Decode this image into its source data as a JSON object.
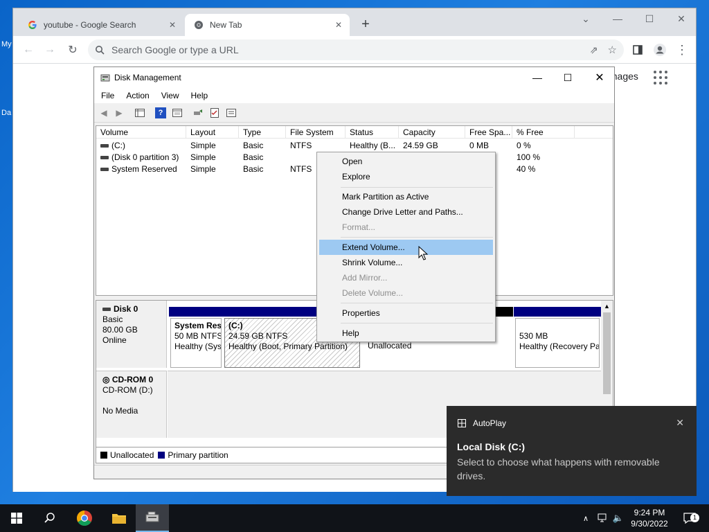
{
  "desktop": {
    "icon_labels": [
      "My",
      "Da"
    ]
  },
  "browser": {
    "tabs": [
      {
        "title": "youtube - Google Search",
        "icon": "google-g-icon",
        "active": false
      },
      {
        "title": "New Tab",
        "icon": "chrome-icon",
        "active": true
      }
    ],
    "omnibox_placeholder": "Search Google or type a URL",
    "images_link": "Images"
  },
  "disk_management": {
    "title": "Disk Management",
    "menu": [
      "File",
      "Action",
      "View",
      "Help"
    ],
    "columns": [
      "Volume",
      "Layout",
      "Type",
      "File System",
      "Status",
      "Capacity",
      "Free Spa...",
      "% Free"
    ],
    "rows": [
      {
        "volume": "(C:)",
        "layout": "Simple",
        "type": "Basic",
        "fs": "NTFS",
        "status": "Healthy (B...",
        "capacity": "24.59 GB",
        "free": "0 MB",
        "pct": "0 %"
      },
      {
        "volume": "(Disk 0 partition 3)",
        "layout": "Simple",
        "type": "Basic",
        "fs": "",
        "status": "",
        "capacity": "",
        "free": "",
        "pct": "100 %"
      },
      {
        "volume": "System Reserved",
        "layout": "Simple",
        "type": "Basic",
        "fs": "NTFS",
        "status": "",
        "capacity": "",
        "free": "",
        "pct": "40 %"
      }
    ],
    "disk0": {
      "name": "Disk 0",
      "type": "Basic",
      "size": "80.00 GB",
      "state": "Online",
      "partitions": [
        {
          "name": "System Res",
          "size": "50 MB NTFS",
          "status": "Healthy (Sys"
        },
        {
          "name": "(C:)",
          "size": "24.59 GB NTFS",
          "status": "Healthy (Boot, Primary Partition)"
        },
        {
          "name": "",
          "size": "",
          "status": "Unallocated"
        },
        {
          "name": "",
          "size": "530 MB",
          "status": "Healthy (Recovery Pa"
        }
      ]
    },
    "cdrom": {
      "name": "CD-ROM 0",
      "type": "CD-ROM (D:)",
      "media": "No Media"
    },
    "legend": [
      {
        "label": "Unallocated",
        "color": "#000000"
      },
      {
        "label": "Primary partition",
        "color": "#000080"
      }
    ]
  },
  "context_menu": {
    "items": [
      {
        "label": "Open",
        "enabled": true
      },
      {
        "label": "Explore",
        "enabled": true
      },
      {
        "label": "Mark Partition as Active",
        "enabled": true
      },
      {
        "label": "Change Drive Letter and Paths...",
        "enabled": true
      },
      {
        "label": "Format...",
        "enabled": false
      },
      {
        "label": "Extend Volume...",
        "enabled": true,
        "highlighted": true
      },
      {
        "label": "Shrink Volume...",
        "enabled": true
      },
      {
        "label": "Add Mirror...",
        "enabled": false
      },
      {
        "label": "Delete Volume...",
        "enabled": false
      },
      {
        "label": "Properties",
        "enabled": true
      },
      {
        "label": "Help",
        "enabled": true
      }
    ]
  },
  "toast": {
    "app": "AutoPlay",
    "title": "Local Disk (C:)",
    "body": "Select to choose what happens with removable drives."
  },
  "taskbar": {
    "time": "9:24 PM",
    "date": "9/30/2022",
    "notification_count": "1"
  },
  "colors": {
    "accent_highlight": "#9dc9f2",
    "primary_partition": "#000080",
    "toast_bg": "#2b2b2b",
    "taskbar_bg": "#101318"
  }
}
